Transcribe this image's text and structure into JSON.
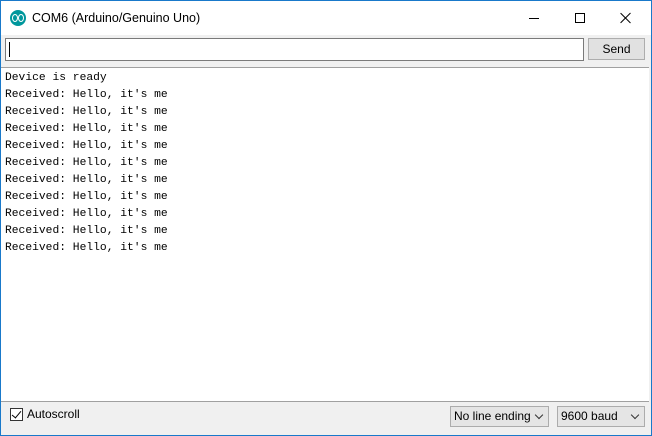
{
  "window": {
    "title": "COM6 (Arduino/Genuino Uno)"
  },
  "send_row": {
    "input_value": "",
    "send_label": "Send"
  },
  "output": {
    "lines": [
      "Device is ready",
      "Received: Hello, it's me",
      "Received: Hello, it's me",
      "Received: Hello, it's me",
      "Received: Hello, it's me",
      "Received: Hello, it's me",
      "Received: Hello, it's me",
      "Received: Hello, it's me",
      "Received: Hello, it's me",
      "Received: Hello, it's me",
      "Received: Hello, it's me"
    ]
  },
  "footer": {
    "autoscroll_label": "Autoscroll",
    "autoscroll_checked": true,
    "line_ending": "No line ending",
    "baud_rate": "9600 baud"
  },
  "icons": {
    "app": "arduino-logo-icon",
    "minimize": "minimize-icon",
    "maximize": "maximize-icon",
    "close": "close-icon",
    "checkbox": "checkmark-icon",
    "dropdown": "chevron-down-icon"
  },
  "colors": {
    "accent": "#00979c",
    "window_border": "#1979ca"
  }
}
